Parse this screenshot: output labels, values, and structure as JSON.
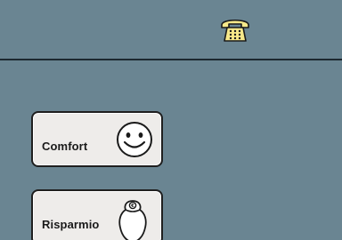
{
  "topbar": {
    "phone_icon": "telephone-icon",
    "phone_color": "#f7e98a"
  },
  "modes": {
    "comfort": {
      "label": "Comfort",
      "icon": "smiley-face-icon"
    },
    "risparmio": {
      "label": "Risparmio",
      "icon": "piggy-bank-icon",
      "icon_symbol": "€"
    }
  },
  "colors": {
    "background": "#6a8592",
    "button_face": "#eeecea",
    "border": "#1f1f1f"
  }
}
